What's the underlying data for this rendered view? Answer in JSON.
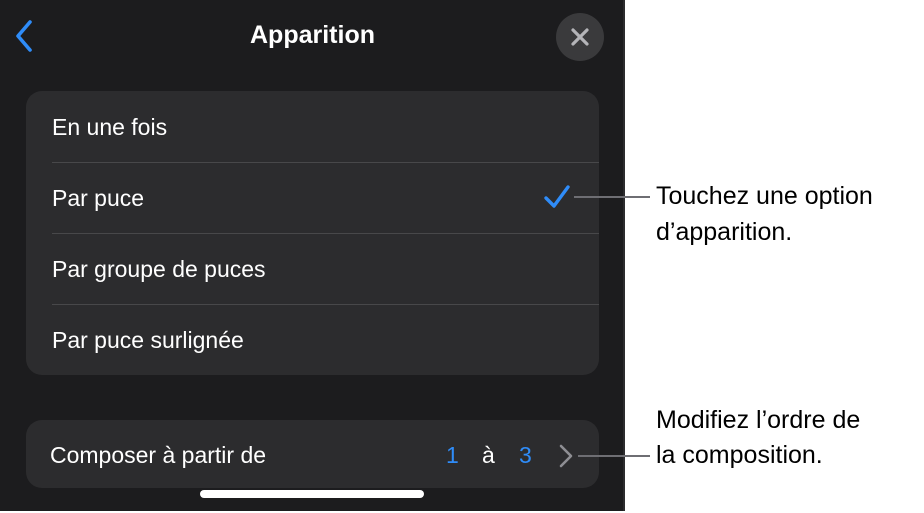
{
  "header": {
    "title": "Apparition"
  },
  "appearance_options": [
    {
      "label": "En une fois",
      "selected": false
    },
    {
      "label": "Par puce",
      "selected": true
    },
    {
      "label": "Par groupe de puces",
      "selected": false
    },
    {
      "label": "Par puce surlignée",
      "selected": false
    }
  ],
  "compose": {
    "label": "Composer à partir de",
    "from": "1",
    "separator": "à",
    "to": "3"
  },
  "callouts": {
    "option": {
      "line1": "Touchez une option",
      "line2": "d’apparition."
    },
    "order": {
      "line1": "Modifiez l’ordre de",
      "line2": "la composition."
    }
  },
  "colors": {
    "accent": "#2f8cf8",
    "panel_background": "#1c1c1e",
    "group_background": "#2c2c2e"
  },
  "icons": {
    "back": "chevron-left-icon",
    "close": "close-icon",
    "selected": "checkmark-icon",
    "disclosure": "chevron-right-icon"
  }
}
